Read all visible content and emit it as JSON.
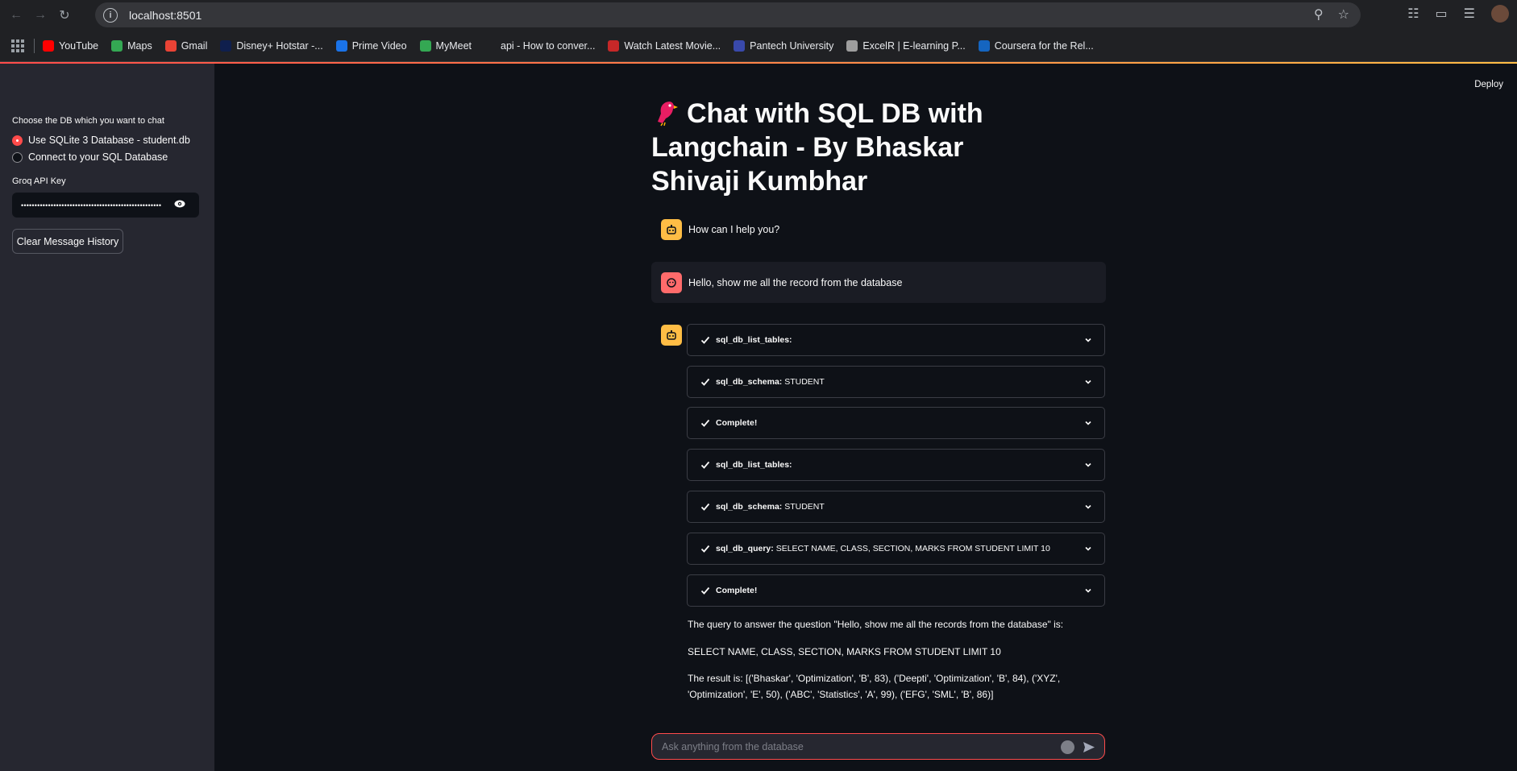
{
  "browser": {
    "url": "localhost:8501",
    "bookmarks": [
      {
        "label": "YouTube",
        "color": "#ff0000"
      },
      {
        "label": "Maps",
        "color": "#34a853"
      },
      {
        "label": "Gmail",
        "color": "#ea4335"
      },
      {
        "label": "Disney+ Hotstar -...",
        "color": "#0f1f4d"
      },
      {
        "label": "Prime Video",
        "color": "#1a73e8"
      },
      {
        "label": "MyMeet",
        "color": "#34a853"
      },
      {
        "label": "api - How to conver...",
        "color": "#202124"
      },
      {
        "label": "Watch Latest Movie...",
        "color": "#c62828"
      },
      {
        "label": "Pantech University",
        "color": "#3949ab"
      },
      {
        "label": "ExcelR | E-learning P...",
        "color": "#9e9e9e"
      },
      {
        "label": "Coursera for the Rel...",
        "color": "#1565c0"
      }
    ]
  },
  "sidebar": {
    "db_label": "Choose the DB which you want to chat",
    "options": [
      "Use SQLite 3 Database - student.db",
      "Connect to your SQL Database"
    ],
    "api_label": "Groq API Key",
    "api_value": "••••••••••••••••••••••••••••••••••••••••••••••••••••",
    "clear_button": "Clear Message History"
  },
  "header": {
    "deploy": "Deploy"
  },
  "main": {
    "title": "Chat with SQL DB with Langchain - By Bhaskar Shivaji Kumbhar",
    "assistant_greeting": "How can I help you?",
    "user_message": "Hello, show me all the record from the database",
    "steps": [
      {
        "name": "sql_db_list_tables:",
        "detail": ""
      },
      {
        "name": "sql_db_schema:",
        "detail": " STUDENT"
      },
      {
        "name": "Complete!",
        "detail": ""
      },
      {
        "name": "sql_db_list_tables:",
        "detail": ""
      },
      {
        "name": "sql_db_schema:",
        "detail": " STUDENT"
      },
      {
        "name": "sql_db_query:",
        "detail": " SELECT NAME, CLASS, SECTION, MARKS FROM STUDENT LIMIT 10"
      },
      {
        "name": "Complete!",
        "detail": ""
      }
    ],
    "answer_line1": "The query to answer the question \"Hello, show me all the records from the database\" is:",
    "answer_line2": "SELECT NAME, CLASS, SECTION, MARKS FROM STUDENT LIMIT 10",
    "answer_line3": "The result is: [('Bhaskar', 'Optimization', 'B', 83), ('Deepti', 'Optimization', 'B', 84), ('XYZ', 'Optimization', 'E', 50), ('ABC', 'Statistics', 'A', 99), ('EFG', 'SML', 'B', 86)]"
  },
  "chat_input": {
    "placeholder": "Ask anything from the database"
  }
}
